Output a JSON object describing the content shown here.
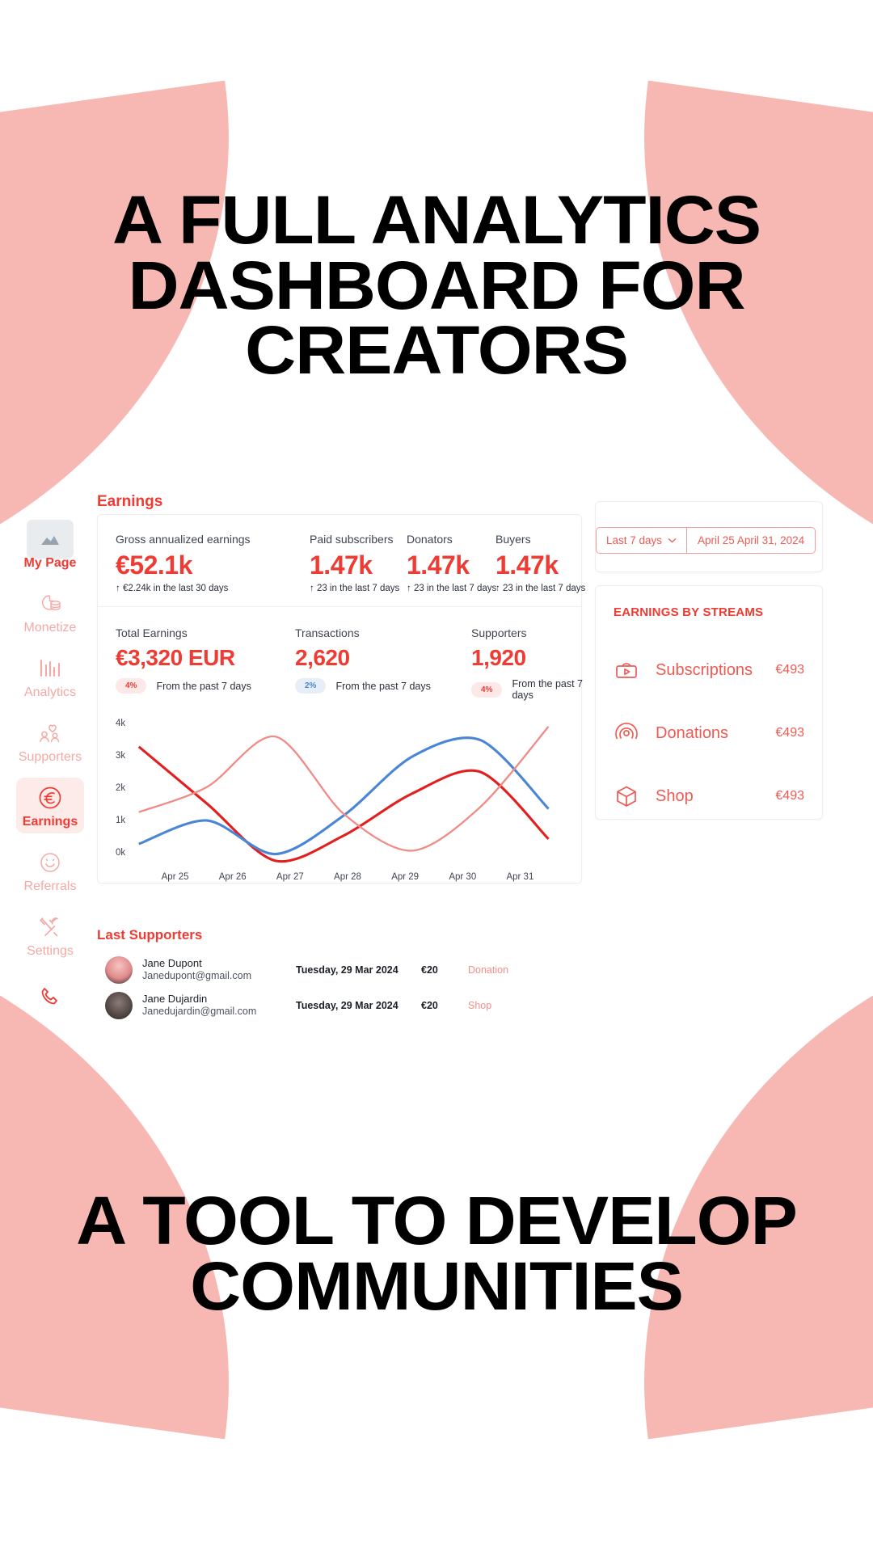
{
  "marketing": {
    "headline_top_lines": [
      "A FULL ANALYTICS",
      "DASHBOARD FOR",
      "CREATORS"
    ],
    "headline_bottom_lines": [
      "A TOOL TO DEVELOP",
      "COMMUNITIES"
    ]
  },
  "colors": {
    "brand_red": "#EE3B33",
    "soft_red": "#EE5A52",
    "pale_pink": "#F7B8B4",
    "blue": "#4A86D6"
  },
  "sidebar": {
    "items": [
      {
        "label": "My Page",
        "icon": "image-thumbnail-icon",
        "state": "page"
      },
      {
        "label": "Monetize",
        "icon": "monetize-clock-coins-icon",
        "state": "idle"
      },
      {
        "label": "Analytics",
        "icon": "bar-chart-icon",
        "state": "idle"
      },
      {
        "label": "Supporters",
        "icon": "people-heart-icon",
        "state": "idle"
      },
      {
        "label": "Earnings",
        "icon": "euro-circle-icon",
        "state": "active"
      },
      {
        "label": "Referrals",
        "icon": "smiley-icon",
        "state": "idle"
      },
      {
        "label": "Settings",
        "icon": "tools-wrench-icon",
        "state": "idle"
      }
    ],
    "footer_icon": "phone-icon"
  },
  "earnings": {
    "panel_title": "Earnings",
    "kpis": [
      {
        "label": "Gross annualized earnings",
        "value": "€52.1k",
        "delta": "↑ €2.24k in the last 30 days"
      },
      {
        "label": "Paid subscribers",
        "value": "1.47k",
        "delta": "↑ 23 in the last 7 days"
      },
      {
        "label": "Donators",
        "value": "1.47k",
        "delta": "↑ 23 in the last 7 days"
      },
      {
        "label": "Buyers",
        "value": "1.47k",
        "delta": "↑ 23 in the last 7 days"
      }
    ],
    "secondary_kpis": [
      {
        "label": "Total Earnings",
        "value": "€3,320 EUR",
        "badge": "4%",
        "badge_tone": "red",
        "note": "From the past 7 days"
      },
      {
        "label": "Transactions",
        "value": "2,620",
        "badge": "2%",
        "badge_tone": "blue",
        "note": "From the past 7 days"
      },
      {
        "label": "Supporters",
        "value": "1,920",
        "badge": "4%",
        "badge_tone": "red",
        "note": "From the past 7 days"
      }
    ]
  },
  "date_picker": {
    "range_label": "Last 7 days",
    "chevron": "⌄",
    "dates_label": "April 25  April 31, 2024"
  },
  "streams": {
    "title": "EARNINGS BY STREAMS",
    "items": [
      {
        "name": "Subscriptions",
        "amount": "€493",
        "icon": "subscriptions-play-bag-icon"
      },
      {
        "name": "Donations",
        "amount": "€493",
        "icon": "donation-target-icon"
      },
      {
        "name": "Shop",
        "amount": "€493",
        "icon": "shop-box-icon"
      }
    ]
  },
  "supporters": {
    "title": "Last Supporters",
    "rows": [
      {
        "name": "Jane Dupont",
        "email": "Janedupont@gmail.com",
        "date": "Tuesday, 29 Mar 2024",
        "amount": "€20",
        "type": "Donation"
      },
      {
        "name": "Jane Dujardin",
        "email": "Janedujardin@gmail.com",
        "date": "Tuesday, 29 Mar 2024",
        "amount": "€20",
        "type": "Shop"
      }
    ]
  },
  "chart_data": {
    "type": "line",
    "title": "",
    "xlabel": "",
    "ylabel": "",
    "categories": [
      "Apr 25",
      "Apr 26",
      "Apr 27",
      "Apr 28",
      "Apr 29",
      "Apr 30",
      "Apr 31"
    ],
    "y_ticks": [
      "0k",
      "1k",
      "2k",
      "3k",
      "4k"
    ],
    "ylim": [
      0,
      4000
    ],
    "grid": false,
    "legend": "none",
    "series": [
      {
        "name": "series-dark-red",
        "color": "#E31E1E",
        "values": [
          3500,
          1800,
          100,
          850,
          2100,
          2750,
          750
        ]
      },
      {
        "name": "series-blue",
        "color": "#4A86D6",
        "values": [
          600,
          1300,
          300,
          1450,
          3200,
          3700,
          1650
        ]
      },
      {
        "name": "series-light-red",
        "color": "#F08B86",
        "values": [
          1550,
          2300,
          3800,
          1500,
          400,
          1700,
          4100
        ]
      }
    ]
  }
}
